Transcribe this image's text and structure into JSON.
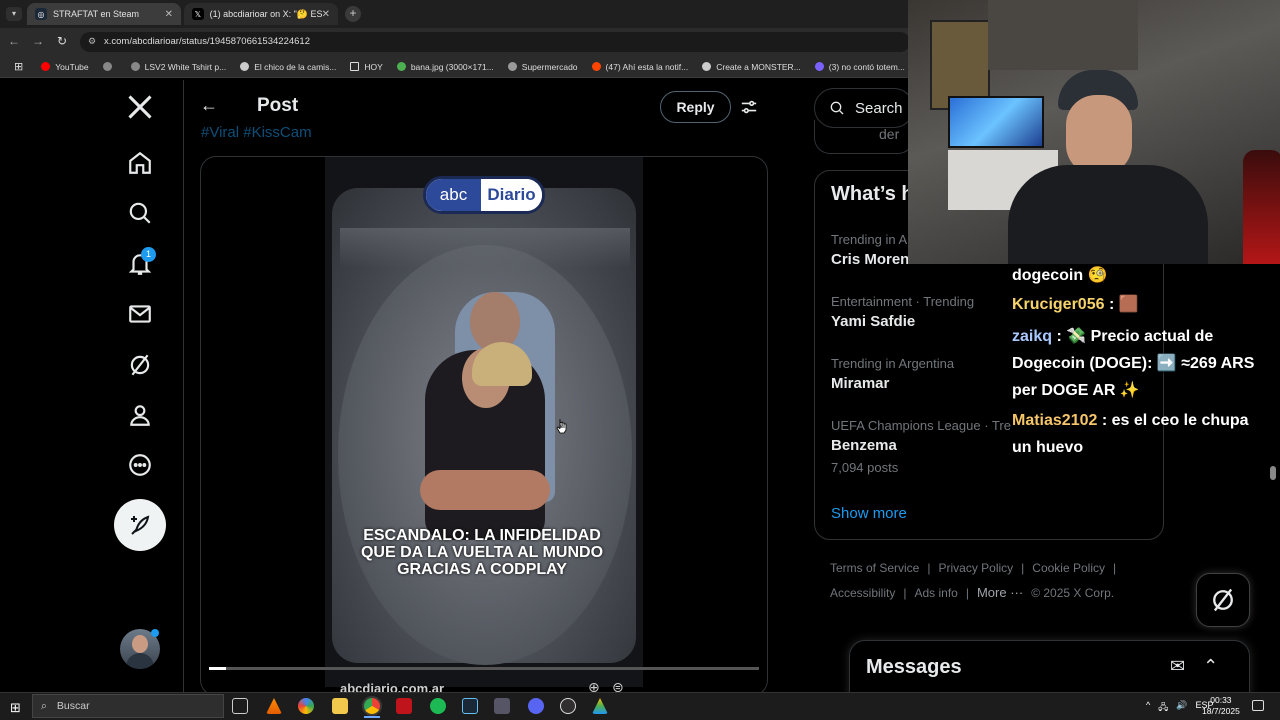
{
  "browser": {
    "tabs": [
      {
        "label": "STRAFTAT en Steam",
        "close": "✕"
      },
      {
        "label": "(1) abcdiarioar on X: \"🤔 ESCÁ",
        "close": "✕"
      }
    ],
    "new_tab": "+",
    "url": "x.com/abcdiarioar/status/1945870661534224612",
    "bookmarks": [
      "YouTube",
      "",
      "LSV2 White Tshirt p...",
      "El chico de la camis...",
      "HOY",
      "bana.jpg (3000×171...",
      "Supermercado",
      "(47) Ahí esta la notif...",
      "Create a MONSTER...",
      "(3) no contó totem..."
    ],
    "bookmark_colors": [
      "#ff0000",
      "#888888",
      "#888888",
      "#cccccc",
      "#dddddd",
      "#4caf50",
      "#999999",
      "#ff4500",
      "#cccccc",
      "#7b61ff"
    ]
  },
  "x_nav": {
    "notification_count": "1"
  },
  "post": {
    "back": "←",
    "title": "Post",
    "reply_label": "Reply",
    "hashtags": "#Viral #KissCam",
    "media_badge_left": "abc",
    "media_badge_right": "Diario",
    "caption": "ESCANDALO: LA INFIDELIDAD QUE DA LA VUELTA AL MUNDO GRACIAS A CODPLAY",
    "source": "abcdiario.com.ar",
    "progress": 0.03
  },
  "sidebar": {
    "search_placeholder": "Search",
    "prev_card_text": "der",
    "trends_title": "What’s h",
    "trends": [
      {
        "category": "Trending in A",
        "name": "Cris Moren",
        "count": ""
      },
      {
        "category": "Entertainment · Trending",
        "name": "Yami Safdie",
        "count": ""
      },
      {
        "category": "Trending in Argentina",
        "name": "Miramar",
        "count": ""
      },
      {
        "category": "UEFA Champions League · Tre",
        "name": "Benzema",
        "count": "7,094 posts"
      }
    ],
    "show_more": "Show more",
    "footer_row1": [
      "Terms of Service",
      "Privacy Policy",
      "Cookie Policy"
    ],
    "footer_row2": [
      "Accessibility",
      "Ads info",
      "More ···",
      "© 2025 X Corp."
    ],
    "footer_sep": "|",
    "messages_title": "Messages"
  },
  "chat": {
    "lines": [
      {
        "user": "",
        "text": "dogecoin 🧐"
      },
      {
        "user": "Kruciger056",
        "text": " : 🟫"
      },
      {
        "user": "zaikq",
        "text": " : 💸 Precio actual de"
      },
      {
        "user": "",
        "text": "Dogecoin (DOGE): ➡️ ≈269 ARS"
      },
      {
        "user": "",
        "text": "per DOGE AR ✨"
      },
      {
        "user": "Matias2102",
        "text": " : es el ceo le chupa"
      },
      {
        "user": "",
        "text": "un huevo"
      }
    ]
  },
  "taskbar": {
    "search": "Buscar",
    "lang": "ESP",
    "time": "00:33",
    "date": "18/7/2025",
    "tray_up": "^",
    "wifi": "🖧",
    "volume": "🔊"
  }
}
